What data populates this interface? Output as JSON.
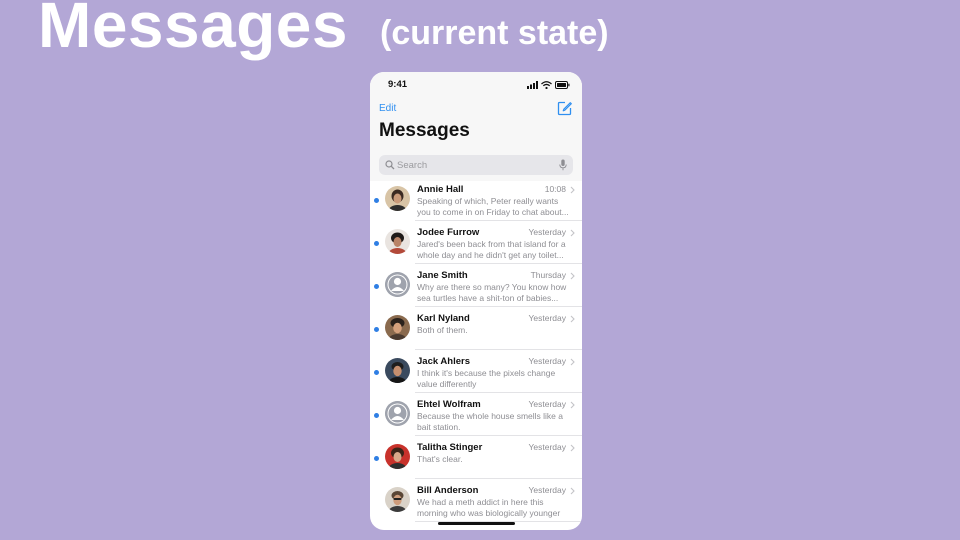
{
  "slide": {
    "title": "Messages",
    "subtitle": "(current state)"
  },
  "colors": {
    "background": "#b3a7d6",
    "accent": "#2f8ff0",
    "unread": "#2f7fe4"
  },
  "status_bar": {
    "time": "9:41",
    "icons": [
      "signal-icon",
      "wifi-icon",
      "battery-icon"
    ]
  },
  "nav": {
    "edit_label": "Edit",
    "compose_icon": "compose-icon",
    "title": "Messages"
  },
  "search": {
    "placeholder": "Search",
    "value": "",
    "icon": "search-icon",
    "mic_icon": "microphone-icon"
  },
  "conversations": [
    {
      "name": "Annie Hall",
      "time": "10:08",
      "preview": "Speaking of which, Peter really wants you to come in on Friday to chat about...",
      "unread": true,
      "avatar": "photo"
    },
    {
      "name": "Jodee Furrow",
      "time": "Yesterday",
      "preview": "Jared's been back from that island for a whole day and he didn't get any toilet...",
      "unread": true,
      "avatar": "photo"
    },
    {
      "name": "Jane Smith",
      "time": "Thursday",
      "preview": "Why are there so many? You know how sea turtles have a shit-ton of babies...",
      "unread": true,
      "avatar": "placeholder"
    },
    {
      "name": "Karl Nyland",
      "time": "Yesterday",
      "preview": "Both of them.",
      "unread": true,
      "avatar": "photo"
    },
    {
      "name": "Jack Ahlers",
      "time": "Yesterday",
      "preview": "I think it's because the pixels change value differently",
      "unread": true,
      "avatar": "photo"
    },
    {
      "name": "Ehtel Wolfram",
      "time": "Yesterday",
      "preview": "Because the whole house smells like a bait station.",
      "unread": true,
      "avatar": "placeholder"
    },
    {
      "name": "Talitha Stinger",
      "time": "Yesterday",
      "preview": "That's clear.",
      "unread": true,
      "avatar": "photo"
    },
    {
      "name": "Bill Anderson",
      "time": "Yesterday",
      "preview": "We had a meth addict in here this morning who was biologically younger",
      "unread": false,
      "avatar": "photo"
    }
  ]
}
